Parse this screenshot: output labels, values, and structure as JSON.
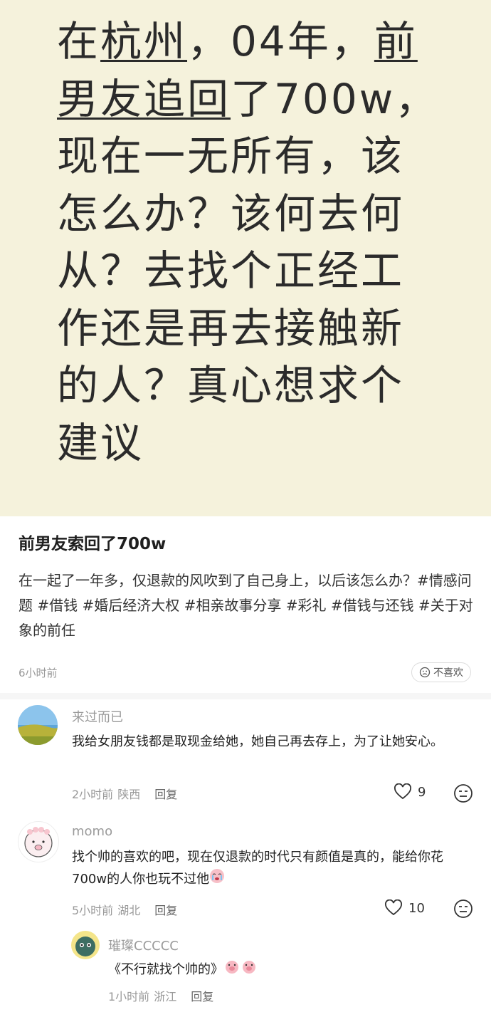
{
  "hero": {
    "lines": [
      [
        "在",
        "杭州",
        "，04年，",
        "前"
      ],
      [
        "男友追回",
        "了700w，"
      ],
      [
        "现在一无所有，该"
      ],
      [
        "怎么办？该何去何"
      ],
      [
        "从？去找个正经工"
      ],
      [
        "作还是再去接触新"
      ],
      [
        "的人？真心想求个"
      ],
      [
        "建议"
      ]
    ]
  },
  "post": {
    "title": "前男友索回了700w",
    "body": "在一起了一年多，仅退款的风吹到了自己身上，以后该怎么办？#情感问题 #借钱 #婚后经济大权 #相亲故事分享 #彩礼 #借钱与还钱 #关于对象的前任",
    "time": "6小时前",
    "dislike_label": "不喜欢"
  },
  "comments": [
    {
      "user": "来过而已",
      "text": "我给女朋友钱都是取现金给她，她自己再去存上，为了让她安心。",
      "time": "2小时前",
      "location": "陕西",
      "reply_label": "回复",
      "likes": "9"
    },
    {
      "user": "momo",
      "text": "找个帅的喜欢的吧，现在仅退款的时代只有颜值是真的，能给你花700w的人你也玩不过他",
      "time": "5小时前",
      "location": "湖北",
      "reply_label": "回复",
      "likes": "10"
    },
    {
      "user": "璀璨CCCCC",
      "text": "《不行就找个帅的》",
      "time": "1小时前",
      "location": "浙江",
      "reply_label": "回复"
    }
  ]
}
